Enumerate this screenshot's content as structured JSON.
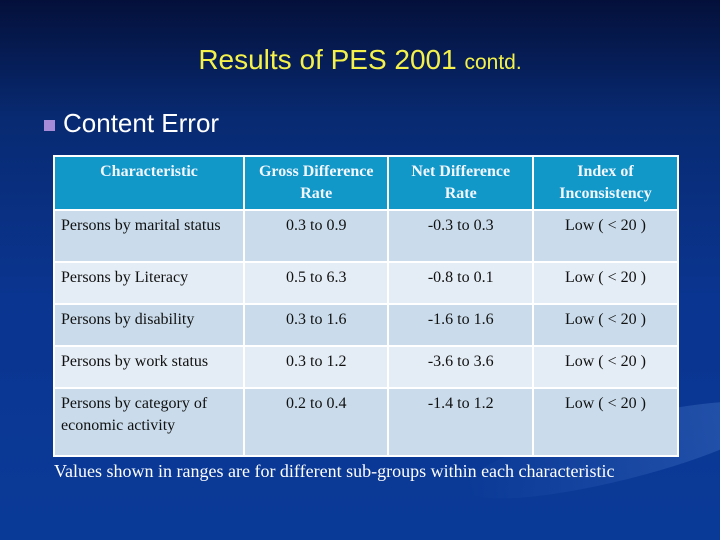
{
  "slide": {
    "title_main": "Results of PES 2001",
    "title_sub": "contd.",
    "bullet": "Content Error",
    "table": {
      "headers": [
        "Characteristic",
        "Gross Difference Rate",
        "Net Difference Rate",
        "Index of Inconsistency"
      ],
      "rows": [
        [
          "Persons by marital status",
          "0.3 to 0.9",
          "-0.3 to 0.3",
          "Low ( < 20 )"
        ],
        [
          "Persons by Literacy",
          "0.5 to 6.3",
          "-0.8 to 0.1",
          "Low ( < 20 )"
        ],
        [
          "Persons by disability",
          "0.3 to 1.6",
          "-1.6 to 1.6",
          "Low ( < 20 )"
        ],
        [
          "Persons by work status",
          "0.3 to 1.2",
          "-3.6 to 3.6",
          "Low ( < 20 )"
        ],
        [
          "Persons by category of economic activity",
          "0.2 to 0.4",
          "-1.4 to 1.2",
          "Low ( < 20 )"
        ]
      ]
    },
    "footnote": "Values shown in ranges are for different sub-groups within each characteristic",
    "colors": {
      "title": "#f4f14a",
      "bullet_square": "#a78ad8",
      "header_bg": "#1197c8",
      "row_odd_bg": "#cadceb",
      "row_even_bg": "#e4edf5"
    }
  }
}
